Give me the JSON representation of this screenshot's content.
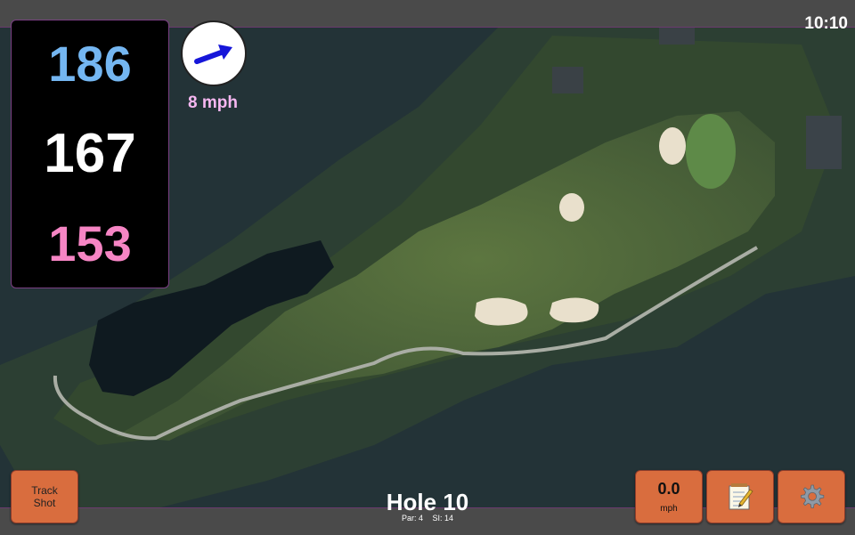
{
  "clock": "10:10",
  "distances": {
    "back": "186",
    "middle": "167",
    "front": "153"
  },
  "wind": {
    "speed": "8 mph",
    "icon": "wind-direction-arrow",
    "color": "#1616d9"
  },
  "hole": {
    "title": "Hole 10",
    "par": "Par: 4",
    "si": "SI: 14"
  },
  "buttons": {
    "track_line1": "Track",
    "track_line2": "Shot",
    "speed_value": "0.0",
    "speed_unit": "mph",
    "notes_icon": "notepad-icon",
    "settings_icon": "gear-icon"
  },
  "colors": {
    "accent_button": "#d96d3e",
    "distance_back": "#74b6f1",
    "distance_mid": "#ffffff",
    "distance_front": "#f685c4",
    "wind_text": "#f6b7f1"
  }
}
